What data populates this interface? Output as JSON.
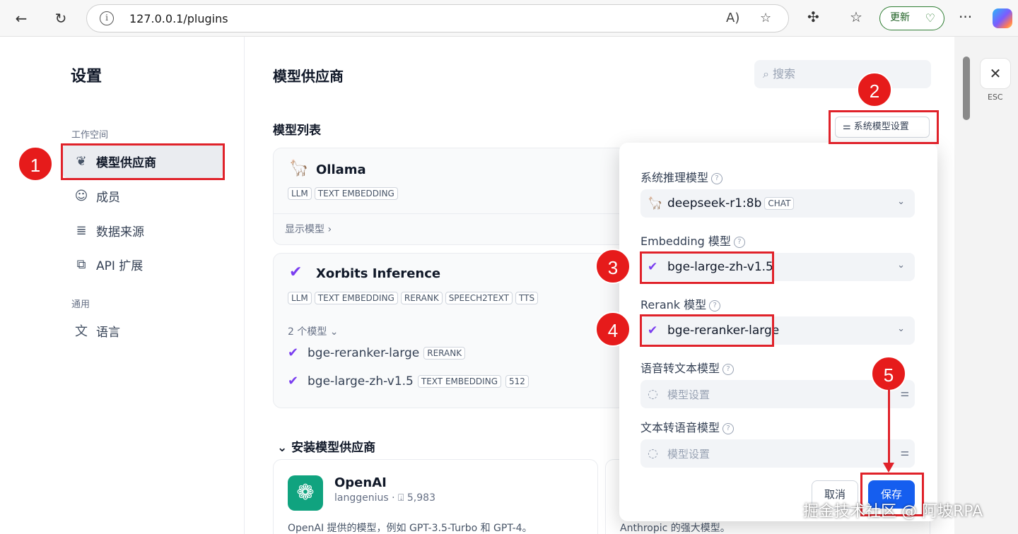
{
  "browser": {
    "url": "127.0.0.1/plugins",
    "update_label": "更新"
  },
  "sidebar": {
    "title": "设置",
    "groups": [
      {
        "label": "工作空间",
        "items": [
          {
            "label": "模型供应商",
            "icon": "brain-icon"
          },
          {
            "label": "成员",
            "icon": "members-icon"
          },
          {
            "label": "数据来源",
            "icon": "database-icon"
          },
          {
            "label": "API 扩展",
            "icon": "puzzle-icon"
          }
        ]
      },
      {
        "label": "通用",
        "items": [
          {
            "label": "语言",
            "icon": "language-icon"
          }
        ]
      }
    ]
  },
  "main": {
    "title": "模型供应商",
    "search_placeholder": "搜索",
    "list_title": "模型列表",
    "system_model_button": "系统模型设置",
    "providers": [
      {
        "name": "Ollama",
        "tags": [
          "LLM",
          "TEXT EMBEDDING"
        ],
        "link": "显示模型 ›"
      },
      {
        "name": "Xorbits Inference",
        "tags": [
          "LLM",
          "TEXT EMBEDDING",
          "RERANK",
          "SPEECH2TEXT",
          "TTS"
        ],
        "models_count": "2 个模型 ⌄",
        "models": [
          {
            "name": "bge-reranker-large",
            "tags": [
              "RERANK"
            ]
          },
          {
            "name": "bge-large-zh-v1.5",
            "tags": [
              "TEXT EMBEDDING",
              "512"
            ]
          }
        ]
      }
    ],
    "install_title": "安装模型供应商",
    "install_cards": [
      {
        "name": "OpenAI",
        "author": "langgenius",
        "downloads": "5,983",
        "description": "OpenAI 提供的模型，例如 GPT-3.5-Turbo 和 GPT-4。"
      },
      {
        "description": "Anthropic 的强大模型。"
      }
    ]
  },
  "popup": {
    "fields": [
      {
        "label": "系统推理模型",
        "value": "deepseek-r1:8b",
        "tag": "CHAT"
      },
      {
        "label": "Embedding 模型",
        "value": "bge-large-zh-v1.5"
      },
      {
        "label": "Rerank 模型",
        "value": "bge-reranker-large"
      },
      {
        "label": "语音转文本模型",
        "value": "模型设置"
      },
      {
        "label": "文本转语音模型",
        "value": "模型设置"
      }
    ],
    "cancel_label": "取消",
    "save_label": "保存"
  },
  "esc_label": "ESC",
  "annotations": [
    "1",
    "2",
    "3",
    "4",
    "5"
  ],
  "watermark": "掘金技术社区 @ 阿坡RPA",
  "colors": {
    "accent": "#155eef",
    "annotation_red": "#e0222a",
    "update_green": "#2e7d32"
  }
}
